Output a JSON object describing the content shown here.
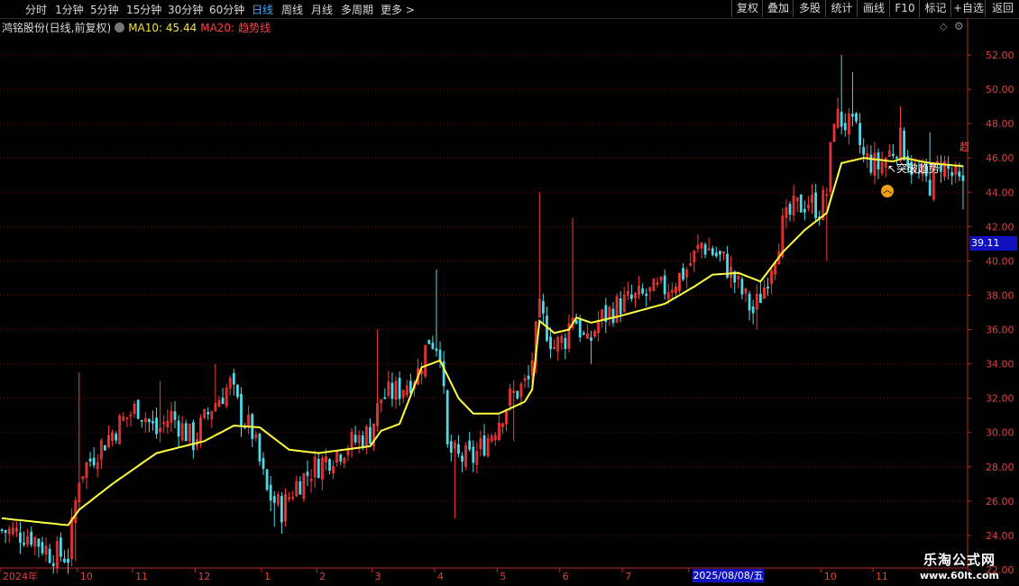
{
  "toolbar": {
    "periods": [
      "分时",
      "1分钟",
      "5分钟",
      "15分钟",
      "30分钟",
      "60分钟",
      "日线",
      "周线",
      "月线",
      "多周期",
      "更多 >"
    ],
    "active_period": "日线",
    "right_buttons": [
      "复权",
      "叠加",
      "多股",
      "统计",
      "画线",
      "F10",
      "标记",
      "+自选",
      "返回"
    ]
  },
  "legend": {
    "stock": "鸿铭股份(日线,前复权)",
    "ma10": "MA10: 45.44",
    "ma20": "MA20:",
    "trend": "趋势线"
  },
  "price_tag": "39.11",
  "date_tag": "2025/08/08/五",
  "annotation": "↖突破趋势",
  "edge_label": "趋",
  "watermark": {
    "line1": "乐淘公式网",
    "line2": "www.60lt.com"
  },
  "colors": {
    "up": "#ff3b3b",
    "down": "#4fd8e8",
    "ma": "#ffff40",
    "axis": "#e04040",
    "bg": "#000000"
  },
  "chart_data": {
    "type": "candlestick",
    "ylim": [
      22,
      53
    ],
    "y_ticks": [
      "52.00",
      "50.00",
      "48.00",
      "46.00",
      "44.00",
      "42.00",
      "40.00",
      "38.00",
      "36.00",
      "34.00",
      "32.00",
      "30.00",
      "28.00",
      "26.00",
      "24.00",
      "22.00"
    ],
    "x_ticks": [
      {
        "label": "2024年",
        "i": 0
      },
      {
        "label": "10",
        "i": 21
      },
      {
        "label": "11",
        "i": 36
      },
      {
        "label": "12",
        "i": 53
      },
      {
        "label": "1",
        "i": 71
      },
      {
        "label": "2",
        "i": 86
      },
      {
        "label": "3",
        "i": 101
      },
      {
        "label": "4",
        "i": 118
      },
      {
        "label": "5",
        "i": 135
      },
      {
        "label": "6",
        "i": 152
      },
      {
        "label": "7",
        "i": 169
      },
      {
        "label": "8",
        "i": 187
      },
      {
        "label": "10",
        "i": 223
      },
      {
        "label": "11",
        "i": 237
      }
    ],
    "ma_anchors": [
      [
        0,
        25.0
      ],
      [
        18,
        24.6
      ],
      [
        21,
        25.5
      ],
      [
        30,
        27.0
      ],
      [
        42,
        28.8
      ],
      [
        55,
        29.5
      ],
      [
        63,
        30.4
      ],
      [
        70,
        30.3
      ],
      [
        78,
        29.0
      ],
      [
        86,
        28.8
      ],
      [
        100,
        29.2
      ],
      [
        103,
        30.1
      ],
      [
        108,
        30.5
      ],
      [
        114,
        33.8
      ],
      [
        119,
        34.2
      ],
      [
        124,
        32.0
      ],
      [
        128,
        31.1
      ],
      [
        135,
        31.1
      ],
      [
        142,
        31.8
      ],
      [
        144,
        32.5
      ],
      [
        146,
        36.5
      ],
      [
        150,
        35.8
      ],
      [
        154,
        36.0
      ],
      [
        156,
        36.7
      ],
      [
        160,
        36.4
      ],
      [
        168,
        36.8
      ],
      [
        180,
        37.5
      ],
      [
        188,
        38.5
      ],
      [
        193,
        39.2
      ],
      [
        200,
        39.3
      ],
      [
        206,
        38.8
      ],
      [
        212,
        40.5
      ],
      [
        218,
        41.8
      ],
      [
        224,
        42.8
      ],
      [
        228,
        45.7
      ],
      [
        234,
        46.0
      ],
      [
        242,
        45.8
      ],
      [
        245,
        46.0
      ],
      [
        252,
        45.7
      ],
      [
        262,
        45.5
      ]
    ],
    "anchors": [
      [
        0,
        24.3
      ],
      [
        8,
        24.0
      ],
      [
        13,
        23.0
      ],
      [
        18,
        22.8
      ],
      [
        21,
        27.5
      ],
      [
        26,
        29.0
      ],
      [
        32,
        30.5
      ],
      [
        37,
        31.5
      ],
      [
        42,
        30.0
      ],
      [
        46,
        31.0
      ],
      [
        52,
        29.5
      ],
      [
        57,
        31.5
      ],
      [
        62,
        32.8
      ],
      [
        65,
        31.0
      ],
      [
        68,
        30.0
      ],
      [
        72,
        26.5
      ],
      [
        76,
        25.5
      ],
      [
        80,
        27.0
      ],
      [
        85,
        28.0
      ],
      [
        92,
        29.0
      ],
      [
        100,
        30.0
      ],
      [
        103,
        32.0
      ],
      [
        108,
        32.5
      ],
      [
        113,
        33.5
      ],
      [
        116,
        35.5
      ],
      [
        119,
        35.0
      ],
      [
        121,
        29.0
      ],
      [
        124,
        28.5
      ],
      [
        128,
        28.5
      ],
      [
        133,
        30.0
      ],
      [
        138,
        32.0
      ],
      [
        143,
        33.0
      ],
      [
        146,
        37.0
      ],
      [
        150,
        35.0
      ],
      [
        153,
        35.5
      ],
      [
        155,
        37.0
      ],
      [
        159,
        35.0
      ],
      [
        162,
        36.5
      ],
      [
        168,
        37.5
      ],
      [
        175,
        38.0
      ],
      [
        181,
        38.5
      ],
      [
        186,
        39.5
      ],
      [
        190,
        41.0
      ],
      [
        193,
        40.5
      ],
      [
        196,
        40.0
      ],
      [
        200,
        38.5
      ],
      [
        204,
        37.0
      ],
      [
        207,
        38.5
      ],
      [
        212,
        42.0
      ],
      [
        215,
        43.0
      ],
      [
        219,
        43.5
      ],
      [
        222,
        43.0
      ],
      [
        224,
        44.0
      ],
      [
        226,
        48.5
      ],
      [
        229,
        48.0
      ],
      [
        232,
        47.5
      ],
      [
        234,
        46.0
      ],
      [
        238,
        45.5
      ],
      [
        242,
        46.5
      ],
      [
        244,
        47.0
      ],
      [
        248,
        45.0
      ],
      [
        252,
        44.5
      ],
      [
        255,
        45.8
      ],
      [
        258,
        45.0
      ],
      [
        261,
        44.2
      ]
    ],
    "spikes": [
      [
        21,
        33.5
      ],
      [
        43,
        33.0
      ],
      [
        58,
        34.0
      ],
      [
        102,
        36.0
      ],
      [
        118,
        39.5
      ],
      [
        146,
        44.0
      ],
      [
        155,
        42.5
      ],
      [
        228,
        52.0
      ],
      [
        231,
        51.0
      ],
      [
        244,
        49.0
      ],
      [
        252,
        47.5
      ]
    ],
    "dips": [
      [
        20,
        22.5
      ],
      [
        74,
        24.5
      ],
      [
        77,
        24.5
      ],
      [
        123,
        25.0
      ],
      [
        139,
        29.5
      ],
      [
        160,
        34.0
      ],
      [
        205,
        36.0
      ],
      [
        224,
        40.0
      ],
      [
        261,
        43.0
      ]
    ],
    "count": 262
  }
}
